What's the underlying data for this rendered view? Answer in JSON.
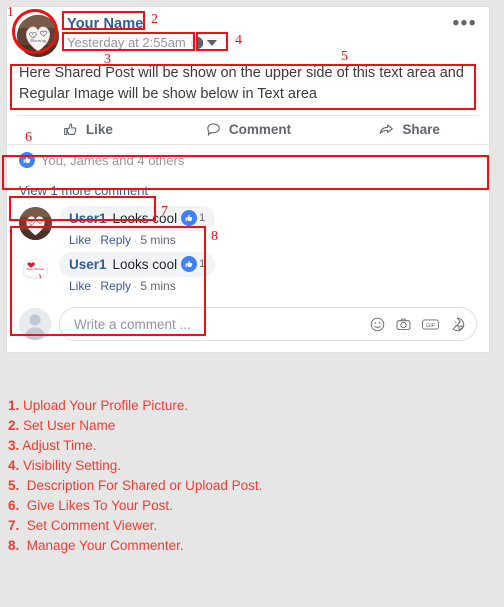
{
  "page": {
    "background_color": "#e6e6e6",
    "annotation_color": "#ee1111"
  },
  "post": {
    "author_name": "Your Name",
    "timestamp": "Yesterday at 2:55am",
    "visibility_icon": "globe-public-icon",
    "visibility_caret": "chevron-down-icon",
    "menu_label": "•••",
    "body_text": "Here Shared Post will be show on the upper side of this text area and Regular Image will be show below in Text area",
    "avatar_icon": "profile-picture-heart-cake"
  },
  "actions": [
    {
      "label": "Like",
      "icon": "thumbs-up-icon"
    },
    {
      "label": "Comment",
      "icon": "comment-bubble-icon"
    },
    {
      "label": "Share",
      "icon": "share-arrow-icon"
    }
  ],
  "reactions": {
    "icon": "like-badge-icon",
    "text": "You, James and 4 others"
  },
  "view_more": {
    "label": "View 1 more comment"
  },
  "comments": [
    {
      "user": "User1",
      "text": "Looks cool",
      "like_count": "1",
      "like_label": "Like",
      "reply_label": "Reply",
      "time": "5 mins",
      "avatar_icon": "commenter-avatar-heart-cake",
      "separator": "·"
    },
    {
      "user": "User1",
      "text": "Looks cool",
      "like_count": "1",
      "like_label": "Like",
      "reply_label": "Reply",
      "time": "5 mins",
      "avatar_icon": "commenter-avatar-round-cake",
      "separator": "·"
    }
  ],
  "composer": {
    "placeholder": "Write a comment ...",
    "value": "",
    "avatar_icon": "default-user-avatar",
    "icons": [
      {
        "name": "emoji-icon",
        "glyph": "emoji"
      },
      {
        "name": "camera-icon",
        "glyph": "camera"
      },
      {
        "name": "gif-icon",
        "glyph": "GIF"
      },
      {
        "name": "sticker-icon",
        "glyph": "sticker"
      }
    ]
  },
  "annotation_numbers": [
    "1",
    "2",
    "3",
    "4",
    "5",
    "6",
    "7",
    "8"
  ],
  "legend": [
    {
      "num": "1.",
      "text": " Upload Your Profile Picture."
    },
    {
      "num": "2.",
      "text": " Set User Name"
    },
    {
      "num": "3.",
      "text": " Adjust Time."
    },
    {
      "num": "4.",
      "text": " Visibility Setting."
    },
    {
      "num": "5.",
      "text": "  Description For Shared or Upload Post."
    },
    {
      "num": "6.",
      "text": "  Give Likes To Your Post."
    },
    {
      "num": "7.",
      "text": "  Set Comment Viewer."
    },
    {
      "num": "8.",
      "text": "  Manage Your Commenter."
    }
  ]
}
